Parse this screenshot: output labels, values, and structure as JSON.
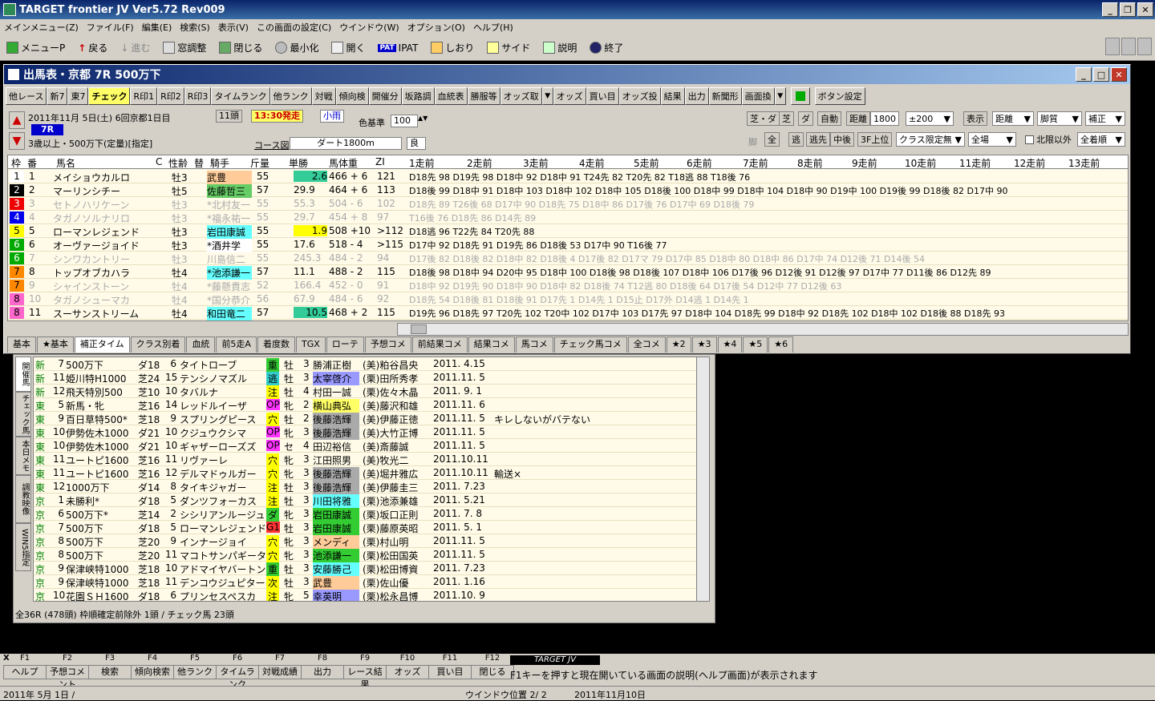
{
  "app": {
    "title": "TARGET frontier JV  Ver5.72  Rev009"
  },
  "menu": [
    "メインメニュー(Z)",
    "ファイル(F)",
    "編集(E)",
    "検索(S)",
    "表示(V)",
    "この画面の設定(C)",
    "ウインドウ(W)",
    "オプション(O)",
    "ヘルプ(H)"
  ],
  "toolbar": {
    "menu": "メニューP",
    "back": "戻る",
    "forward": "進む",
    "window_adjust": "窓調整",
    "close": "閉じる",
    "minimize": "最小化",
    "open": "開く",
    "ipat": "IPAT",
    "bookmark": "しおり",
    "side": "サイド",
    "help": "説明",
    "exit": "終了"
  },
  "win1": {
    "title": "出馬表・京都 7R 500万下",
    "buttons": [
      "他レース",
      "新7",
      "東7",
      "チェック",
      "R印1",
      "R印2",
      "R印3",
      "タイムランク",
      "他ランク",
      "対戦",
      "傾向検",
      "開催分",
      "坂路調",
      "血統表",
      "勝服等",
      "オッズ取",
      "オッズ",
      "買い目",
      "オッズ投",
      "結果",
      "出力",
      "新聞形",
      "画面換",
      "ボタン設定"
    ],
    "date": "2011年11月 5日(土) 6回京都1日目",
    "race_no": "11頭",
    "post_time": "13:30発走",
    "weather": "小雨",
    "race_badge": "7R",
    "condition": "3歳以上・500万下(定量)[指定]",
    "color_base_label": "色基準",
    "color_base": "100",
    "course_label": "コース図",
    "course": "ダート1800m",
    "going": "良",
    "ctrl": {
      "turf_dirt": "芝・ダ",
      "turf": "芝",
      "dirt": "ダ",
      "auto": "自動",
      "dist_label": "距離",
      "dist": "1800",
      "range": "±200",
      "display_label": "表示",
      "display": "距離",
      "kyakushitsu": "脚質",
      "hosei": "補正",
      "all": "全",
      "nige": "逃",
      "nigesaki": "逃先",
      "chugo": "中後",
      "top3f": "3F上位",
      "class_limit": "クラス限定無",
      "venue": "全場",
      "limit_out": "北限以外",
      "order": "全着順",
      "ashi": "脚"
    },
    "headers": [
      "枠",
      "番",
      "馬名",
      "C",
      "性齢",
      "替",
      "騎手",
      "斤量",
      "単勝",
      "馬体重",
      "ZI",
      "1走前",
      "2走前",
      "3走前",
      "4走前",
      "5走前",
      "6走前",
      "7走前",
      "8走前",
      "9走前",
      "10走前",
      "11走前",
      "12走前",
      "13走前"
    ],
    "rows": [
      {
        "waku": "1",
        "num": "1",
        "name": "メイショウカルロ",
        "sa": "牡3",
        "jockey": "武豊",
        "kin": "55",
        "odds": "2.6",
        "weight": "466 + 6",
        "zi": "121",
        "runs": "D18先 98 D19先 98 D18中 92 D18中 91 T24先 82 T20先 82 T18逃 88 T18後 76",
        "fade": false
      },
      {
        "waku": "2",
        "num": "2",
        "name": "マーリンシチー",
        "sa": "牡5",
        "jockey": "佐藤哲三",
        "kin": "57",
        "odds": "29.9",
        "weight": "464 + 6",
        "zi": "113",
        "runs": "D18後 99 D18中 91 D18中 103 D18中 102 D18中 105 D18後 100 D18中 99 D18中 104 D18中 90 D19中 100 D19後 99 D18後 82 D17中 90",
        "fade": false
      },
      {
        "waku": "3",
        "num": "3",
        "name": "セトノハリケーン",
        "sa": "牡3",
        "jockey": "*北村友一",
        "kin": "55",
        "odds": "55.3",
        "weight": "504 - 6",
        "zi": "102",
        "runs": "D18先 89 T26後 68 D17中 90 D18先 75 D18中 86 D17後 76 D17中 69 D18後 79",
        "fade": true
      },
      {
        "waku": "4",
        "num": "4",
        "name": "タガノソルナリロ",
        "sa": "牡3",
        "jockey": "*福永祐一",
        "kin": "55",
        "odds": "29.7",
        "weight": "454 + 8",
        "zi": "97",
        "runs": "T16後 76 D18先 86 D14先 89",
        "fade": true
      },
      {
        "waku": "5",
        "num": "5",
        "name": "ローマンレジェンド",
        "sa": "牡3",
        "jockey": "岩田康誠",
        "kin": "55",
        "odds": "1.9",
        "weight": "508 +10",
        "zi": ">112",
        "runs": "D18逃 96 T22先 84 T20先 88",
        "fade": false
      },
      {
        "waku": "6",
        "num": "6",
        "name": "オーヴァージョイド",
        "sa": "牡3",
        "jockey": "*酒井学",
        "kin": "55",
        "odds": "17.6",
        "weight": "518 - 4",
        "zi": ">115",
        "runs": "D17中 92 D18先 91 D19先 86 D18後 53 D17中 90 T16後 77",
        "fade": false
      },
      {
        "waku": "6",
        "num": "7",
        "name": "シンワカントリー",
        "sa": "牡3",
        "jockey": "川島信二",
        "kin": "55",
        "odds": "245.3",
        "weight": "484 - 2",
        "zi": "94",
        "runs": "D17後 82 D18後 82 D18中 82 D18後 4 D17後 82 D17マ 79 D17中 85 D18中 80 D18中 86 D17中 74 D12後 71 D14後 54",
        "fade": true
      },
      {
        "waku": "7",
        "num": "8",
        "name": "トップオブカハラ",
        "sa": "牡4",
        "jockey": "*池添謙一",
        "kin": "57",
        "odds": "11.1",
        "weight": "488 - 2",
        "zi": "115",
        "runs": "D18後 98 D18中 94 D20中 95 D18中 100 D18後 98 D18後 107 D18中 106 D17後 96 D12後 91 D12後 97 D17中 77 D11後 86 D12先 89",
        "fade": false
      },
      {
        "waku": "7",
        "num": "9",
        "name": "シャインストーン",
        "sa": "牡4",
        "jockey": "*藤懸貴志",
        "kin": "52",
        "odds": "166.4",
        "weight": "452 - 0",
        "zi": "91",
        "runs": "D18中 92 D19先 90 D18中 90 D18中 82 D18後 74 T12逃 80 D18後 64 D17後 54 D12中 77 D12後 63",
        "fade": true
      },
      {
        "waku": "8",
        "num": "10",
        "name": "タガノシューマカ",
        "sa": "牡4",
        "jockey": "*国分恭介",
        "kin": "56",
        "odds": "67.9",
        "weight": "484 - 6",
        "zi": "92",
        "runs": "D18先 54 D18後 81 D18後 91 D17先 1 D14先 1 D15止 D17外 D14逃 1 D14先 1",
        "fade": true
      },
      {
        "waku": "8",
        "num": "11",
        "name": "スーサンストリーム",
        "sa": "牡4",
        "jockey": "和田竜二",
        "kin": "57",
        "odds": "10.5",
        "weight": "468 + 2",
        "zi": "115",
        "runs": "D19先 96 D18先 97 T20先 102 T20中 102 D17中 103 D17先 97 D18中 104 D18先 99 D18中 92 D18先 102 D18中 102 D18後 88 D18先 93",
        "fade": false
      }
    ],
    "tabs": [
      "基本",
      "★基本",
      "補正タイム",
      "クラス別着",
      "血統",
      "前5走A",
      "着度数",
      "TGX",
      "ローテ",
      "予想コメ",
      "前結果コメ",
      "結果コメ",
      "馬コメ",
      "チェック馬コメ",
      "全コメ",
      "★2",
      "★3",
      "★4",
      "★5",
      "★6"
    ]
  },
  "win2": {
    "vtabs": [
      "開催馬",
      "チェック馬",
      "本日メモ",
      "調教映像",
      "WIN5指定"
    ],
    "rows": [
      {
        "venue": "新",
        "r": "7",
        "race": "500万下",
        "course": "ダ18",
        "num": "6",
        "name": "タイトローブ",
        "mark": "重",
        "sex": "牡",
        "age": "3",
        "jockey": "勝浦正樹",
        "trainer": "(美)粕谷昌央",
        "date": "2011. 4.15",
        "memo": ""
      },
      {
        "venue": "新",
        "r": "11",
        "race": "姫川特H1000",
        "course": "芝24",
        "num": "15",
        "name": "テンシノマズル",
        "mark": "逃",
        "sex": "牡",
        "age": "3",
        "jockey": "太宰啓介",
        "trainer": "(栗)田所秀孝",
        "date": "2011.11. 5",
        "memo": ""
      },
      {
        "venue": "新",
        "r": "12",
        "race": "飛天特別500",
        "course": "芝10",
        "num": "10",
        "name": "タバルナ",
        "mark": "注",
        "sex": "牡",
        "age": "4",
        "jockey": "村田一誠",
        "trainer": "(栗)佐々木晶",
        "date": "2011. 9. 1",
        "memo": ""
      },
      {
        "venue": "東",
        "r": "5",
        "race": "新馬・牝",
        "course": "芝16",
        "num": "14",
        "name": "レッドルイーザ",
        "mark": "OP",
        "sex": "牝",
        "age": "2",
        "jockey": "横山典弘",
        "trainer": "(美)藤沢和雄",
        "date": "2011.11. 6",
        "memo": ""
      },
      {
        "venue": "東",
        "r": "9",
        "race": "百日草特500*",
        "course": "芝18",
        "num": "9",
        "name": "スプリングピース",
        "mark": "穴",
        "sex": "牡",
        "age": "2",
        "jockey": "後藤浩輝",
        "trainer": "(美)伊藤正徳",
        "date": "2011.11. 5",
        "memo": "キレしないがバテない"
      },
      {
        "venue": "東",
        "r": "10",
        "race": "伊勢佐木1000",
        "course": "ダ21",
        "num": "10",
        "name": "クジュウクシマ",
        "mark": "OP",
        "sex": "牝",
        "age": "3",
        "jockey": "後藤浩輝",
        "trainer": "(美)大竹正博",
        "date": "2011.11. 5",
        "memo": ""
      },
      {
        "venue": "東",
        "r": "10",
        "race": "伊勢佐木1000",
        "course": "ダ21",
        "num": "10",
        "name": "ギャザーローズズ",
        "mark": "OP",
        "sex": "セ",
        "age": "4",
        "jockey": "田辺裕信",
        "trainer": "(美)斎藤誠",
        "date": "2011.11. 5",
        "memo": ""
      },
      {
        "venue": "東",
        "r": "11",
        "race": "ユートピ1600",
        "course": "芝16",
        "num": "11",
        "name": "リヴァーレ",
        "mark": "穴",
        "sex": "牝",
        "age": "3",
        "jockey": "江田照男",
        "trainer": "(美)牧光二",
        "date": "2011.10.11",
        "memo": ""
      },
      {
        "venue": "東",
        "r": "11",
        "race": "ユートピ1600",
        "course": "芝16",
        "num": "12",
        "name": "デルマドゥルガー",
        "mark": "穴",
        "sex": "牝",
        "age": "3",
        "jockey": "後藤浩輝",
        "trainer": "(美)堀井雅広",
        "date": "2011.10.11",
        "memo": "輸送×"
      },
      {
        "venue": "東",
        "r": "12",
        "race": "1000万下",
        "course": "ダ14",
        "num": "8",
        "name": "タイキジャガー",
        "mark": "注",
        "sex": "牡",
        "age": "3",
        "jockey": "後藤浩輝",
        "trainer": "(美)伊藤圭三",
        "date": "2011. 7.23",
        "memo": ""
      },
      {
        "venue": "京",
        "r": "1",
        "race": "未勝利*",
        "course": "ダ18",
        "num": "5",
        "name": "ダンツフォーカス",
        "mark": "注",
        "sex": "牡",
        "age": "3",
        "jockey": "川田将雅",
        "trainer": "(栗)池添兼雄",
        "date": "2011. 5.21",
        "memo": ""
      },
      {
        "venue": "京",
        "r": "6",
        "race": "500万下*",
        "course": "芝14",
        "num": "2",
        "name": "シシリアンルージュ",
        "mark": "ダ",
        "sex": "牝",
        "age": "3",
        "jockey": "岩田康誠",
        "trainer": "(栗)坂口正則",
        "date": "2011. 7. 8",
        "memo": ""
      },
      {
        "venue": "京",
        "r": "7",
        "race": "500万下",
        "course": "ダ18",
        "num": "5",
        "name": "ローマンレジェンド",
        "mark": "G1",
        "sex": "牡",
        "age": "3",
        "jockey": "岩田康誠",
        "trainer": "(栗)藤原英昭",
        "date": "2011. 5. 1",
        "memo": ""
      },
      {
        "venue": "京",
        "r": "8",
        "race": "500万下",
        "course": "芝20",
        "num": "9",
        "name": "インナージョイ",
        "mark": "穴",
        "sex": "牝",
        "age": "3",
        "jockey": "メンディ",
        "trainer": "(栗)村山明",
        "date": "2011.11. 5",
        "memo": ""
      },
      {
        "venue": "京",
        "r": "8",
        "race": "500万下",
        "course": "芝20",
        "num": "11",
        "name": "マコトサンパギータ",
        "mark": "穴",
        "sex": "牝",
        "age": "3",
        "jockey": "池添謙一",
        "trainer": "(栗)松田国英",
        "date": "2011.11. 5",
        "memo": ""
      },
      {
        "venue": "京",
        "r": "9",
        "race": "保津峡特1000",
        "course": "芝18",
        "num": "10",
        "name": "アドマイヤバートン",
        "mark": "重",
        "sex": "牡",
        "age": "3",
        "jockey": "安藤勝己",
        "trainer": "(栗)松田博資",
        "date": "2011. 7.23",
        "memo": ""
      },
      {
        "venue": "京",
        "r": "9",
        "race": "保津峡特1000",
        "course": "芝18",
        "num": "11",
        "name": "デンコウジュピター",
        "mark": "次",
        "sex": "牡",
        "age": "3",
        "jockey": "武豊",
        "trainer": "(栗)佐山優",
        "date": "2011. 1.16",
        "memo": ""
      },
      {
        "venue": "京",
        "r": "10",
        "race": "花園ＳＨ1600",
        "course": "ダ18",
        "num": "6",
        "name": "プリンセスペスカ",
        "mark": "注",
        "sex": "牝",
        "age": "5",
        "jockey": "幸英明",
        "trainer": "(栗)松永昌博",
        "date": "2011.10. 9",
        "memo": ""
      }
    ],
    "status": "全36R (478頭) 枠順確定前除外 1頭  / チェック馬 23頭"
  },
  "fkeys": [
    {
      "k": "F1",
      "a": "ヘルプ"
    },
    {
      "k": "F2",
      "a": "予想コメント"
    },
    {
      "k": "F3",
      "a": "検索"
    },
    {
      "k": "F4",
      "a": "傾向検索"
    },
    {
      "k": "F5",
      "a": "他ランク"
    },
    {
      "k": "F6",
      "a": "タイムランク"
    },
    {
      "k": "F7",
      "a": "対戦成績"
    },
    {
      "k": "F8",
      "a": "出力"
    },
    {
      "k": "F9",
      "a": "レース結果"
    },
    {
      "k": "F10",
      "a": "オッズ"
    },
    {
      "k": "F11",
      "a": "買い目"
    },
    {
      "k": "F12",
      "a": "閉じる"
    }
  ],
  "fkey_x": "X",
  "target_logo": "TARGET JV",
  "hint": "F1キーを押すと現在開いている画面の説明(ヘルプ画面)が表示されます",
  "status": {
    "left": "2011年 5月 1日 /",
    "window_pos": "ウインドウ位置 2/ 2",
    "date": "2011年11月10日"
  }
}
